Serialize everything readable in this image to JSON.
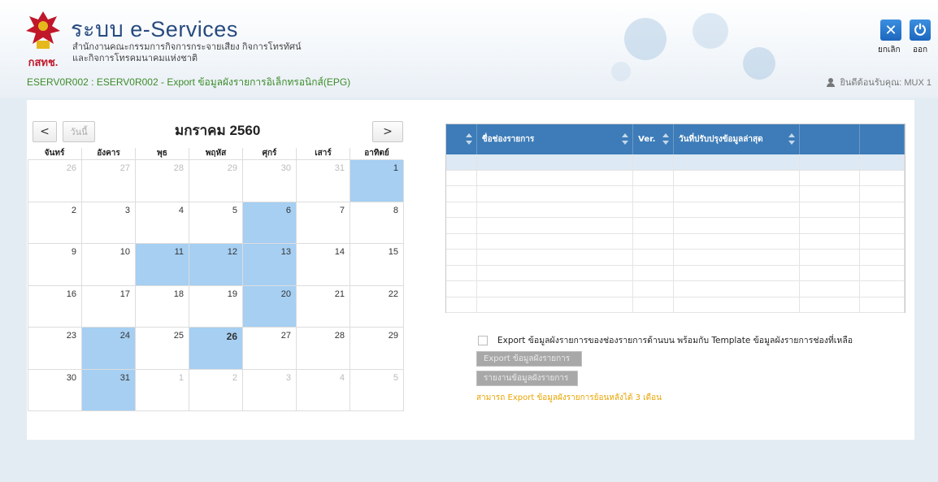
{
  "header": {
    "app_title": "ระบบ e-Services",
    "org_line1": "สำนักงานคณะกรรมการกิจการกระจายเสียง กิจการโทรทัศน์",
    "org_line2": "และกิจการโทรคมนาคมแห่งชาติ",
    "logo_text": "กสทช.",
    "page_heading": "ESERV0R002 : ESERV0R002 - Export ข้อมูลผังรายการอิเล็กทรอนิกส์(EPG)",
    "cancel_label": "ยกเลิก",
    "exit_label": "ออก",
    "welcome": "ยินดีต้อนรับคุณ: MUX 1",
    "brand_color": "#274a7f",
    "accent_color": "#1c67be"
  },
  "calendar": {
    "prev_label": "<",
    "today_label": "วันนี้",
    "next_label": ">",
    "title": "มกราคม 2560",
    "weekdays": [
      "จันทร์",
      "อังคาร",
      "พุธ",
      "พฤหัส",
      "ศุกร์",
      "เสาร์",
      "อาทิตย์"
    ],
    "highlight_color": "#a6cff2",
    "today_day": 26,
    "weeks": [
      [
        {
          "d": "26",
          "o": true
        },
        {
          "d": "27",
          "o": true
        },
        {
          "d": "28",
          "o": true
        },
        {
          "d": "29",
          "o": true
        },
        {
          "d": "30",
          "o": true
        },
        {
          "d": "31",
          "o": true
        },
        {
          "d": "1",
          "h": true
        }
      ],
      [
        {
          "d": "2"
        },
        {
          "d": "3"
        },
        {
          "d": "4"
        },
        {
          "d": "5"
        },
        {
          "d": "6",
          "h": true
        },
        {
          "d": "7"
        },
        {
          "d": "8"
        }
      ],
      [
        {
          "d": "9"
        },
        {
          "d": "10"
        },
        {
          "d": "11",
          "h": true
        },
        {
          "d": "12",
          "h": true
        },
        {
          "d": "13",
          "h": true
        },
        {
          "d": "14"
        },
        {
          "d": "15"
        }
      ],
      [
        {
          "d": "16"
        },
        {
          "d": "17"
        },
        {
          "d": "18"
        },
        {
          "d": "19"
        },
        {
          "d": "20",
          "h": true
        },
        {
          "d": "21"
        },
        {
          "d": "22"
        }
      ],
      [
        {
          "d": "23"
        },
        {
          "d": "24",
          "h": true
        },
        {
          "d": "25"
        },
        {
          "d": "26",
          "h": true,
          "t": true
        },
        {
          "d": "27"
        },
        {
          "d": "28"
        },
        {
          "d": "29"
        }
      ],
      [
        {
          "d": "30"
        },
        {
          "d": "31",
          "h": true
        },
        {
          "d": "1",
          "o": true
        },
        {
          "d": "2",
          "o": true
        },
        {
          "d": "3",
          "o": true
        },
        {
          "d": "4",
          "o": true
        },
        {
          "d": "5",
          "o": true
        }
      ]
    ]
  },
  "table": {
    "columns": [
      "",
      "ชื่อช่องรายการ",
      "Ver.",
      "วันที่ปรับปรุงข้อมูลล่าสุด",
      "",
      ""
    ],
    "empty_rows": 10,
    "header_color": "#3d7cb8"
  },
  "export": {
    "checkbox_label": "Export ข้อมูลผังรายการของช่องรายการด้านบน พร้อมกับ Template ข้อมูลผังรายการช่องที่เหลือ",
    "export_button": "Export ข้อมูลผังรายการ",
    "report_button": "รายงานข้อมูลผังรายการ",
    "note": "สามารถ Export ข้อมูลผังรายการย้อนหลังได้ 3 เดือน",
    "note_color": "#e8a400"
  }
}
